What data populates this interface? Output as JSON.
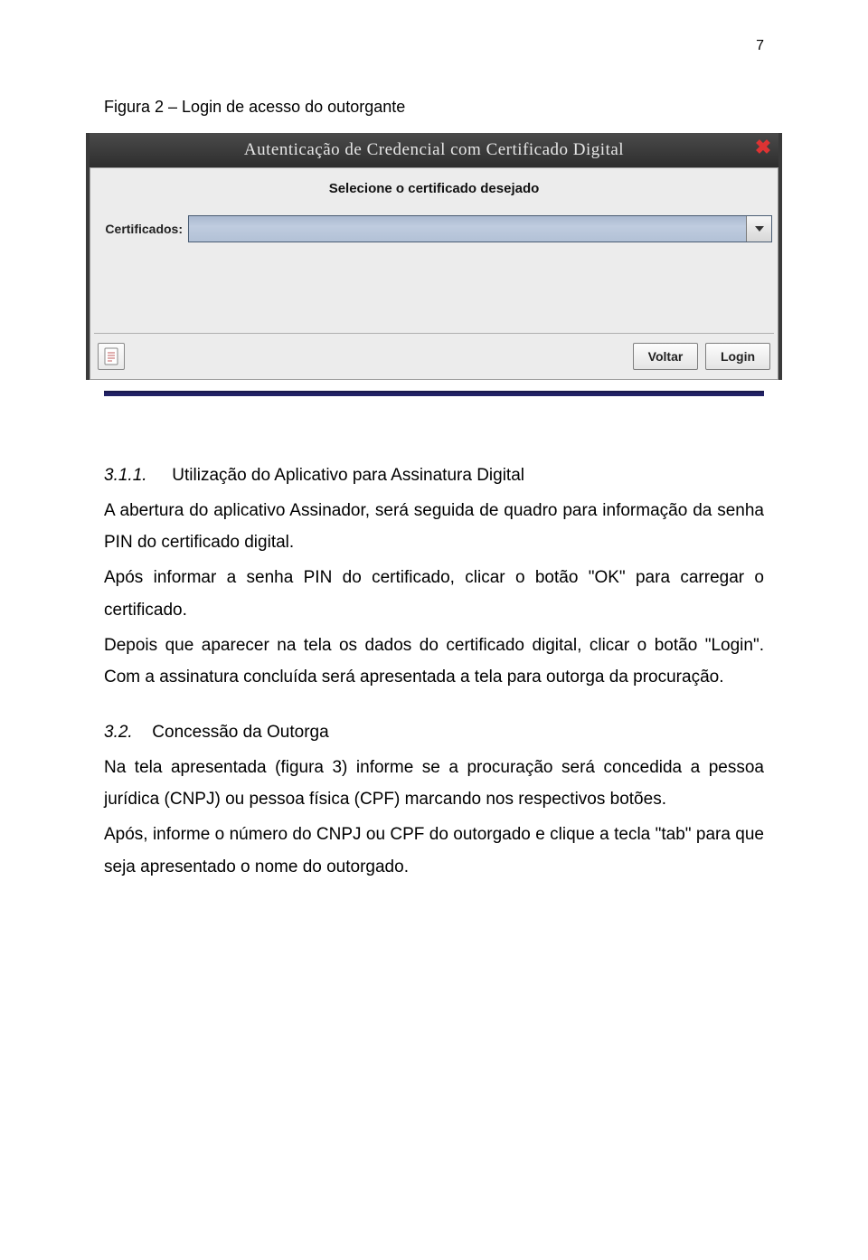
{
  "page_number": "7",
  "figure_caption": "Figura 2 – Login de acesso do outorgante",
  "window": {
    "title": "Autenticação de Credencial com Certificado Digital",
    "instruction": "Selecione o certificado desejado",
    "field_label": "Certificados:",
    "combo_value": "",
    "btn_voltar": "Voltar",
    "btn_login": "Login"
  },
  "section_311": {
    "num": "3.1.1.",
    "title": "Utilização do Aplicativo para Assinatura Digital",
    "p1": "A abertura do aplicativo Assinador, será seguida de quadro para informação da senha PIN do certificado digital.",
    "p2": "Após informar a senha PIN do certificado, clicar o botão \"OK\" para carregar o certificado.",
    "p3": "Depois que aparecer na tela os dados do certificado digital, clicar o botão \"Login\". Com a assinatura concluída será apresentada a tela para outorga da procuração."
  },
  "section_32": {
    "num": "3.2.",
    "title": "Concessão da Outorga",
    "p1": "Na tela apresentada (figura 3) informe se a procuração será concedida a pessoa jurídica (CNPJ) ou pessoa física (CPF) marcando nos respectivos botões.",
    "p2": "Após, informe o número do CNPJ ou CPF do outorgado e clique a tecla \"tab\" para que seja apresentado o nome do outorgado."
  }
}
